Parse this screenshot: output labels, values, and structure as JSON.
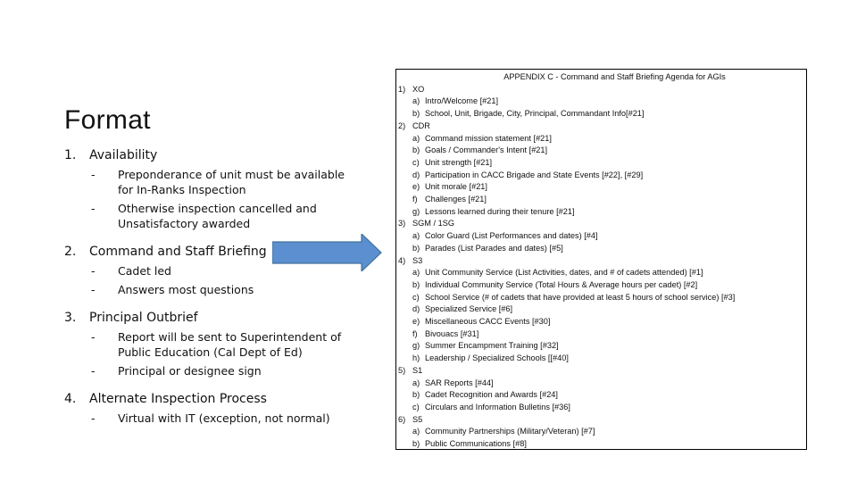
{
  "slide": {
    "title": "Format",
    "items": [
      {
        "num": "1.",
        "label": "Availability",
        "subs": [
          "Preponderance of unit must be available for In-Ranks Inspection",
          "Otherwise inspection cancelled and Unsatisfactory awarded"
        ]
      },
      {
        "num": "2.",
        "label": "Command and Staff Briefing",
        "subs": [
          "Cadet led",
          "Answers most questions"
        ]
      },
      {
        "num": "3.",
        "label": "Principal Outbrief",
        "subs": [
          "Report will be sent to Superintendent of Public Education (Cal Dept of Ed)",
          "Principal or designee sign"
        ]
      },
      {
        "num": "4.",
        "label": "Alternate Inspection Process",
        "subs": [
          "Virtual with IT (exception, not normal)"
        ]
      }
    ],
    "dash": "-",
    "arrow_color": "#5b8fcf",
    "arrow_border": "#41719c"
  },
  "appendix": {
    "title": "APPENDIX C - Command and Staff Briefing Agenda for AGIs",
    "sections": [
      {
        "num": "1)",
        "label": "XO",
        "items": [
          {
            "letter": "a)",
            "text": "Intro/Welcome [#21]"
          },
          {
            "letter": "b)",
            "text": "School, Unit, Brigade, City, Principal, Commandant Info[#21]"
          }
        ]
      },
      {
        "num": "2)",
        "label": "CDR",
        "items": [
          {
            "letter": "a)",
            "text": "Command mission statement [#21]"
          },
          {
            "letter": "b)",
            "text": "Goals / Commander's Intent [#21]"
          },
          {
            "letter": "c)",
            "text": "Unit strength [#21]"
          },
          {
            "letter": "d)",
            "text": "Participation in CACC Brigade and State Events [#22], [#29]"
          },
          {
            "letter": "e)",
            "text": "Unit morale [#21]"
          },
          {
            "letter": "f)",
            "text": "Challenges [#21]"
          },
          {
            "letter": "g)",
            "text": "Lessons learned during their tenure [#21]"
          }
        ]
      },
      {
        "num": "3)",
        "label": "SGM / 1SG",
        "items": [
          {
            "letter": "a)",
            "text": "Color Guard (List Performances and dates) [#4]"
          },
          {
            "letter": "b)",
            "text": "Parades (List Parades and dates) [#5]"
          }
        ]
      },
      {
        "num": "4)",
        "label": "S3",
        "items": [
          {
            "letter": "a)",
            "text": "Unit Community Service (List Activities, dates, and # of cadets attended) [#1]"
          },
          {
            "letter": "b)",
            "text": "Individual Community Service (Total Hours & Average hours per cadet) [#2]"
          },
          {
            "letter": "c)",
            "text": "School Service (# of cadets that have provided at least 5 hours of school service) [#3]"
          },
          {
            "letter": "d)",
            "text": "Specialized Service [#6]"
          },
          {
            "letter": "e)",
            "text": "Miscellaneous CACC Events [#30]"
          },
          {
            "letter": "f)",
            "text": "Bivouacs [#31]"
          },
          {
            "letter": "g)",
            "text": "Summer Encampment Training [#32]"
          },
          {
            "letter": "h)",
            "text": "Leadership / Specialized Schools [[#40]"
          }
        ]
      },
      {
        "num": "5)",
        "label": "S1",
        "items": [
          {
            "letter": "a)",
            "text": "SAR Reports [#44]"
          },
          {
            "letter": "b)",
            "text": "Cadet Recognition and Awards [#24]"
          },
          {
            "letter": "c)",
            "text": "Circulars and Information Bulletins [#36]"
          }
        ]
      },
      {
        "num": "6)",
        "label": "S5",
        "items": [
          {
            "letter": "a)",
            "text": "Community Partnerships (Military/Veteran) [#7]"
          },
          {
            "letter": "b)",
            "text": "Public Communications [#8]"
          }
        ]
      }
    ]
  }
}
